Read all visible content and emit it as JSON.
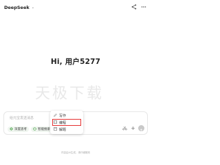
{
  "header": {
    "title": "DeepSeek"
  },
  "main": {
    "greeting": "Hi, 用户5277",
    "watermark": "天极下载"
  },
  "menu": {
    "items": [
      {
        "label": "写作",
        "icon": "pencil-icon"
      },
      {
        "label": "编程",
        "icon": "code-icon"
      },
      {
        "label": "解题",
        "icon": "calculator-icon"
      }
    ]
  },
  "input": {
    "placeholder": "给元宝发送消息",
    "chips": [
      {
        "label": "深度思考",
        "icon": "atom-icon"
      },
      {
        "label": "智能搜索",
        "icon": "globe-icon"
      },
      {
        "label": "工具",
        "icon": "tools-icon"
      }
    ]
  },
  "footer": {
    "disclaimer": "内容由AI生成，请仔细甄别"
  },
  "colors": {
    "accent": "#e53030",
    "chip_bg": "#f0f6f0",
    "send_disabled": "#c9c9c9"
  }
}
